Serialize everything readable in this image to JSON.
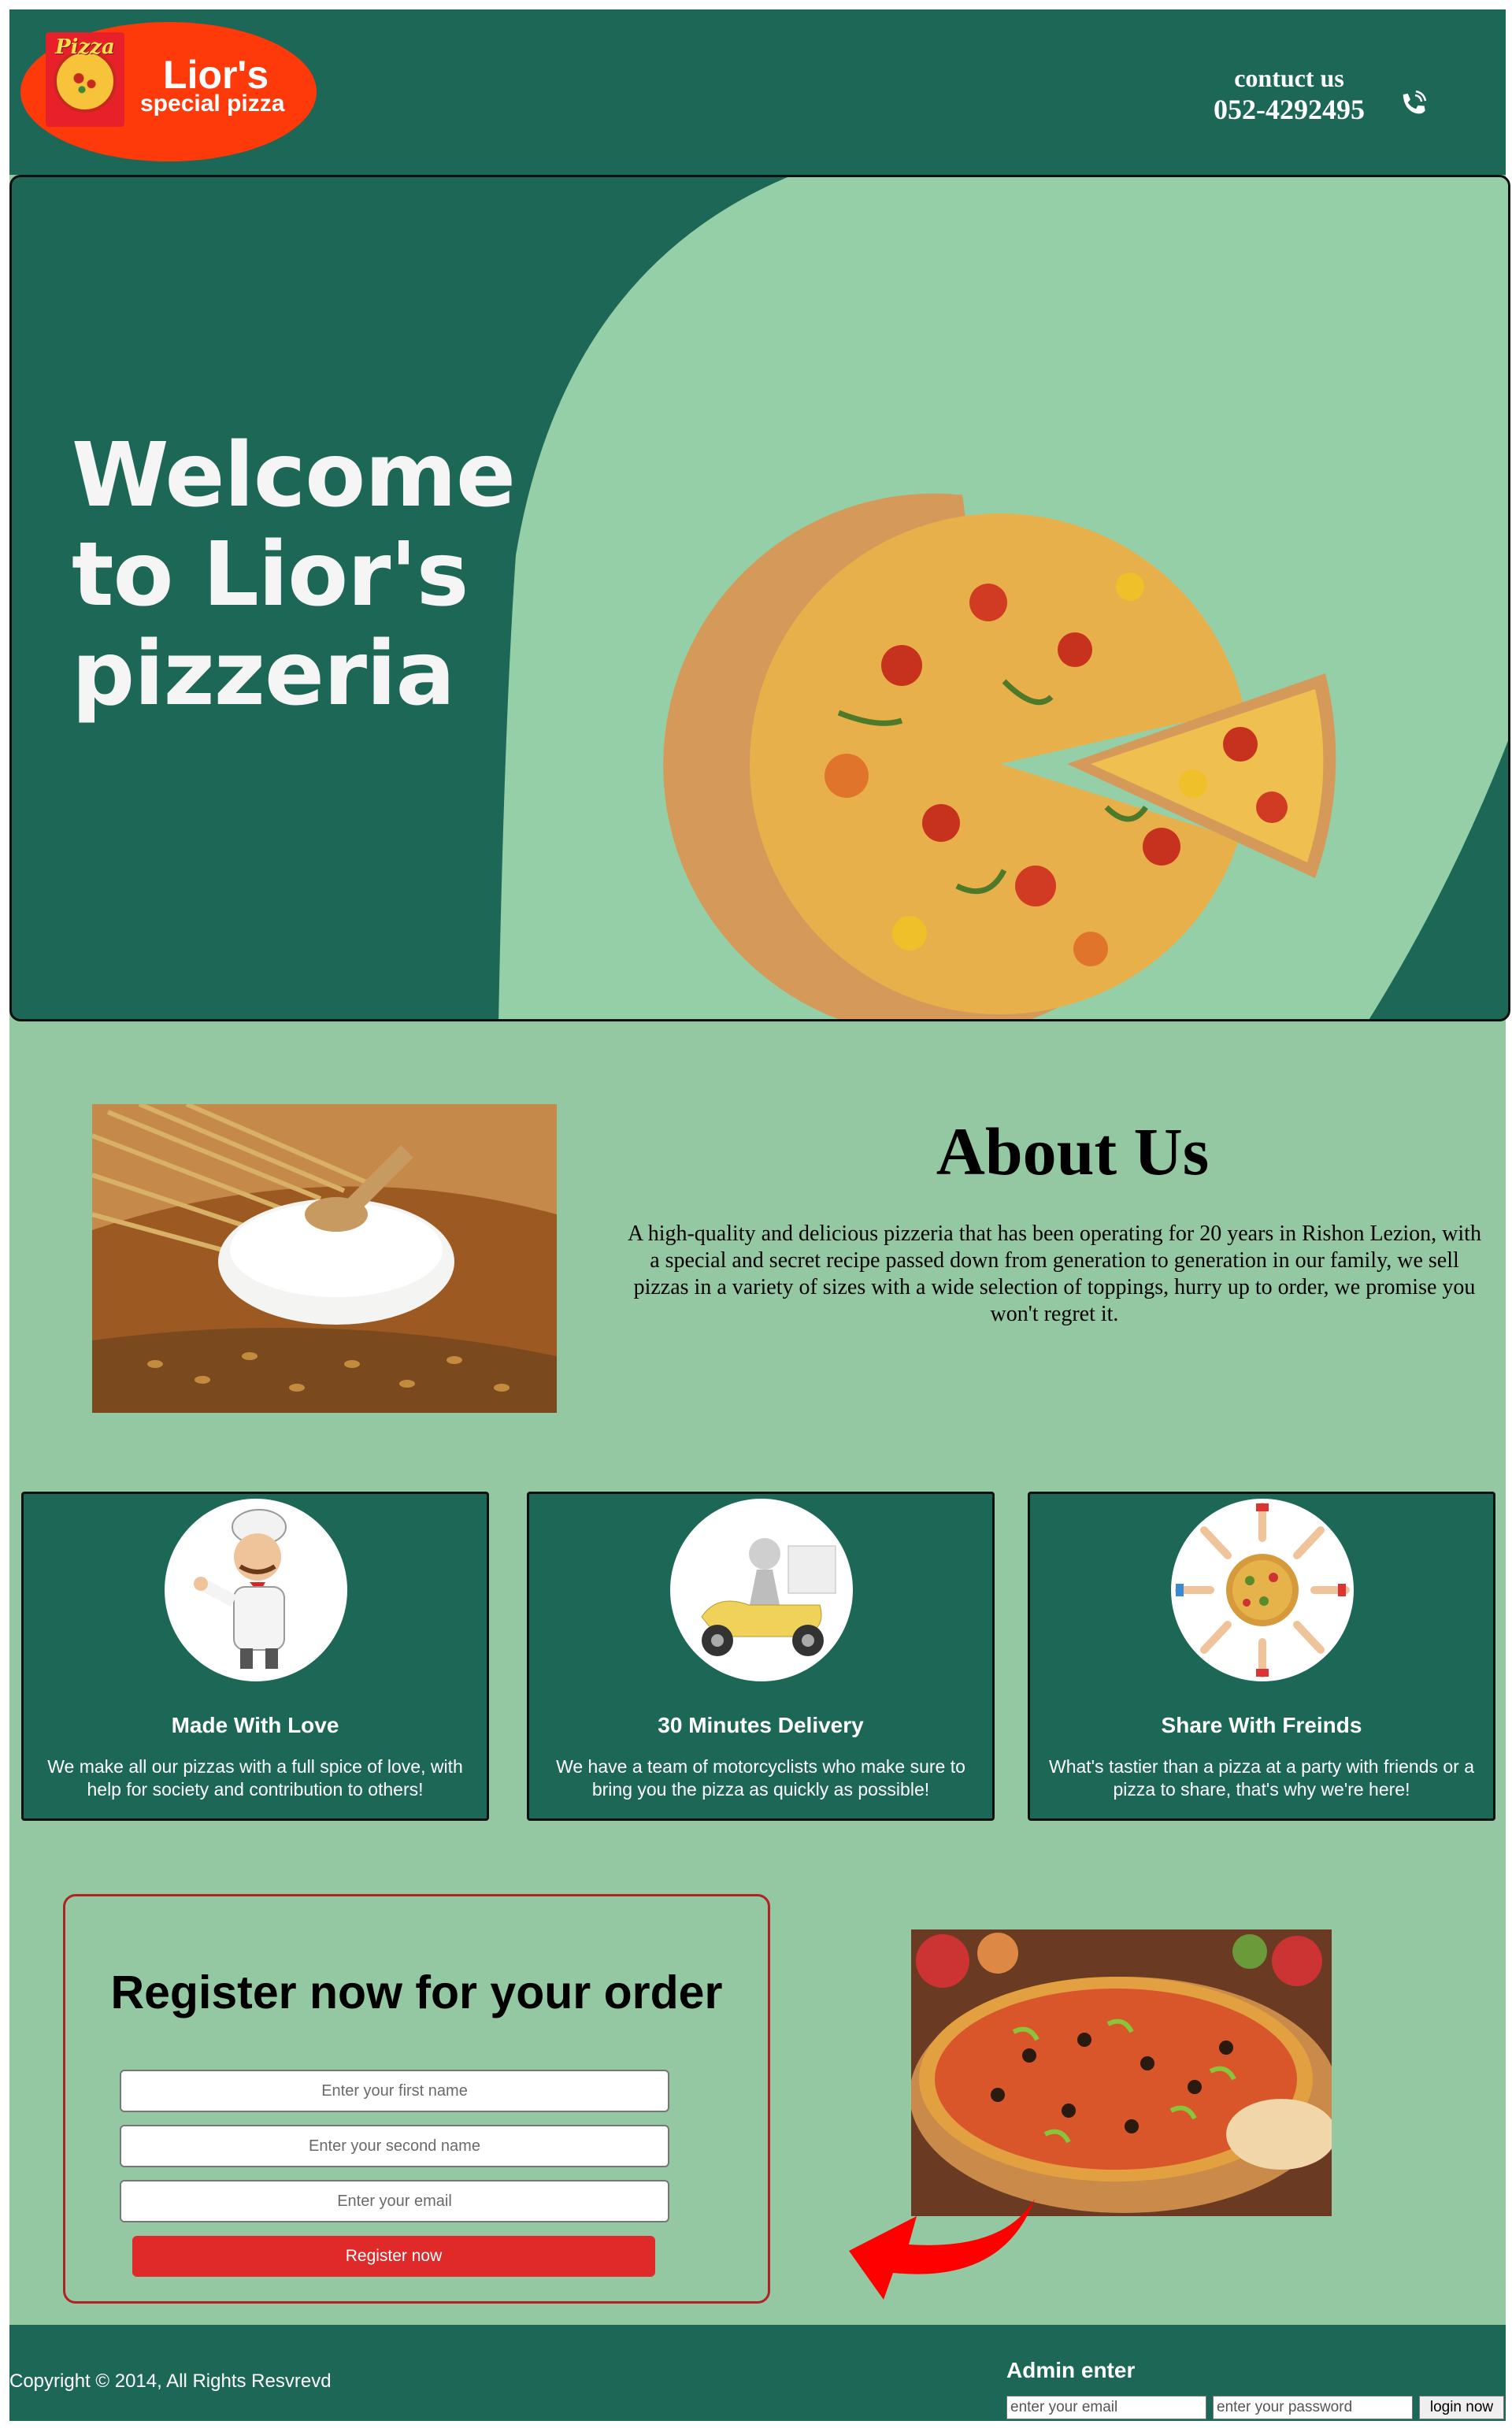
{
  "header": {
    "logo_badge_text": "Pizza",
    "logo_title": "Lior's",
    "logo_subtitle": "special pizza",
    "contact_label": "contuct us",
    "contact_phone": "052-4292495",
    "phone_icon": "phone-ringing-icon"
  },
  "hero": {
    "title": "Welcome to Lior's pizzeria"
  },
  "about": {
    "title": "About Us",
    "text": "A high-quality and delicious pizzeria that has been operating for 20 years in Rishon Lezion, with a special and secret recipe passed down from generation to generation in our family, we sell pizzas in a variety of sizes with a wide selection of toppings, hurry up to order, we promise you won't regret it."
  },
  "features": [
    {
      "title": "Made With Love",
      "text": "We make all our pizzas with a full spice of love, with help for society and contribution to others!"
    },
    {
      "title": "30 Minutes Delivery",
      "text": "We have a team of motorcyclists who make sure to bring you the pizza as quickly as possible!"
    },
    {
      "title": "Share With Freinds",
      "text": "What's tastier than a pizza at a party with friends or a pizza to share, that's why we're here!"
    }
  ],
  "register": {
    "title": "Register now for your order",
    "first_name_placeholder": "Enter your first name",
    "second_name_placeholder": "Enter your second name",
    "email_placeholder": "Enter your email",
    "button_label": "Register now"
  },
  "footer": {
    "copyright": "Copyright © 2014, All Rights Resvrevd",
    "admin_title": "Admin enter",
    "admin_email_placeholder": "enter your email",
    "admin_password_placeholder": "enter your password",
    "admin_button_label": "login now"
  },
  "colors": {
    "dark_green": "#1d6757",
    "light_green": "#93c8a2",
    "logo_red": "#ff3a0a",
    "register_button": "#e02a2a"
  }
}
